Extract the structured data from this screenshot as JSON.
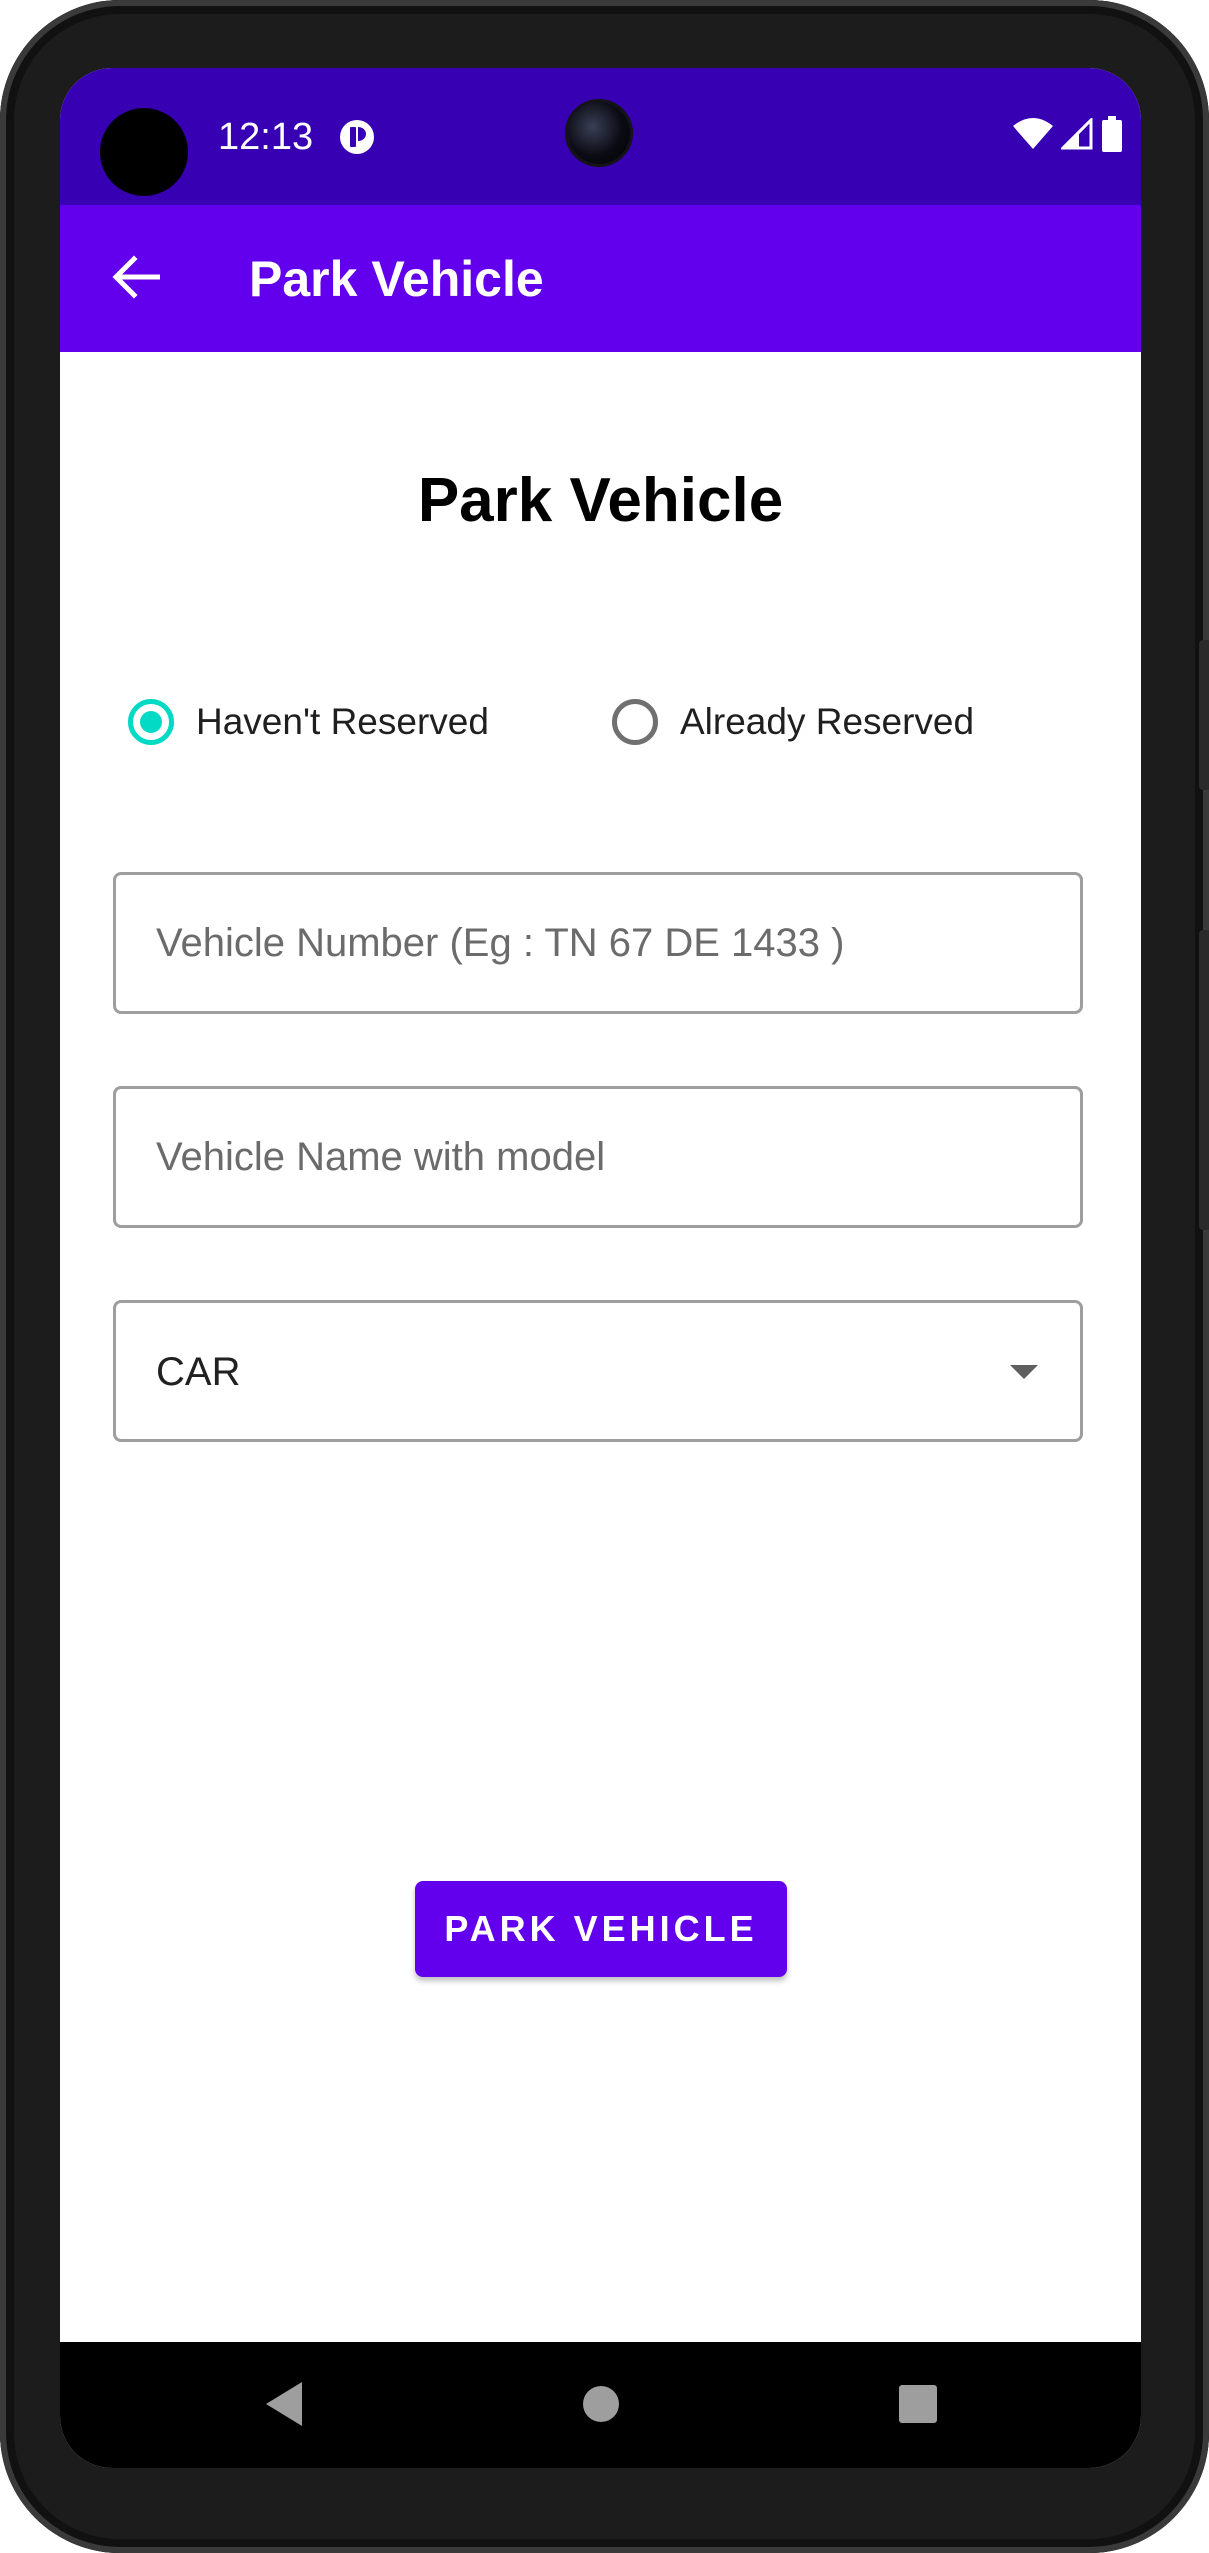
{
  "status_bar": {
    "time": "12:13",
    "left_icon": "data-saver-icon",
    "right_icons": [
      "wifi-icon",
      "signal-icon",
      "battery-icon"
    ],
    "background": "#3700b3"
  },
  "app_bar": {
    "back_icon": "arrow-left-icon",
    "title": "Park Vehicle",
    "background": "#6200ee"
  },
  "main": {
    "title": "Park Vehicle",
    "reservation_options": [
      {
        "label": "Haven't Reserved",
        "selected": true
      },
      {
        "label": "Already Reserved",
        "selected": false
      }
    ],
    "vehicle_number": {
      "placeholder": "Vehicle Number (Eg : TN 67 DE 1433 )",
      "value": ""
    },
    "vehicle_name": {
      "placeholder": "Vehicle Name with model",
      "value": ""
    },
    "vehicle_type": {
      "selected": "CAR"
    },
    "submit_label": "PARK VEHICLE",
    "accent_color": "#03dac5",
    "primary_color": "#6200ee"
  },
  "nav_bar": {
    "buttons": [
      "back-triangle-icon",
      "home-circle-icon",
      "recents-square-icon"
    ]
  }
}
